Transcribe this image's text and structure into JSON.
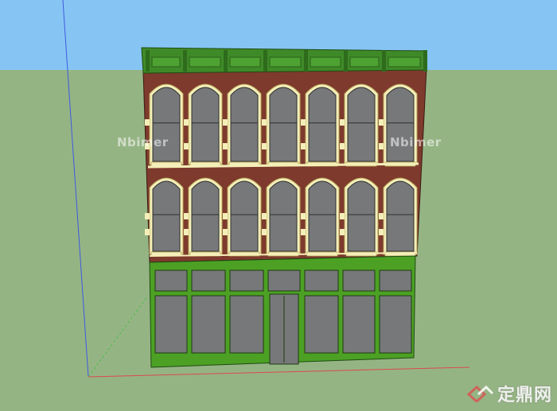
{
  "viewport": {
    "watermark": "Nbimer",
    "brand_logo_text": "定鼎网"
  },
  "colors": {
    "sky": "#86c5f3",
    "ground": "#95b484",
    "brick": "#7e3a2d",
    "cornice": "#3f8a28",
    "storefront": "#4ca124",
    "trim": "#f4efb8",
    "glass": "#76787a",
    "axis_blue": "#3f5ae0",
    "axis_red": "#d94b4b",
    "axis_green": "#4bbd4b"
  }
}
